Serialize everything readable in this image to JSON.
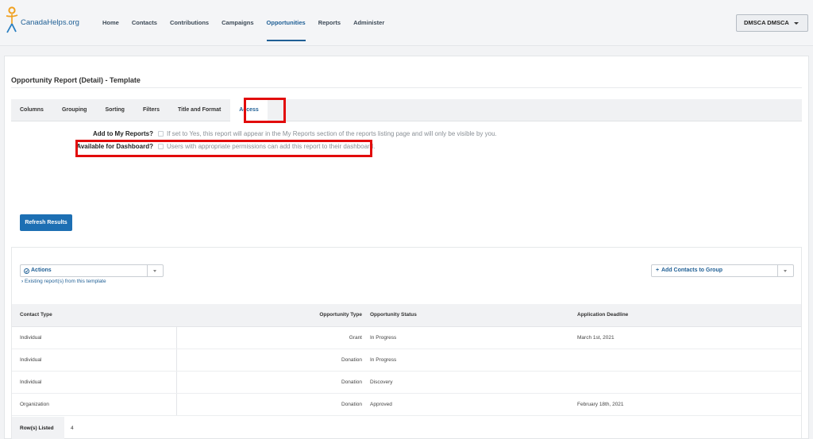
{
  "brand": {
    "name": "CanadaHelps.org",
    "accent": "#1f5f95",
    "highlight": "#e20b0b"
  },
  "nav": {
    "items": [
      {
        "label": "Home",
        "active": false
      },
      {
        "label": "Contacts",
        "active": false
      },
      {
        "label": "Contributions",
        "active": false
      },
      {
        "label": "Campaigns",
        "active": false
      },
      {
        "label": "Opportunities",
        "active": true
      },
      {
        "label": "Reports",
        "active": false
      },
      {
        "label": "Administer",
        "active": false
      }
    ],
    "user_label": "DMSCA DMSCA"
  },
  "page": {
    "title": "Opportunity Report (Detail) - Template"
  },
  "tabs": [
    {
      "label": "Columns"
    },
    {
      "label": "Grouping"
    },
    {
      "label": "Sorting"
    },
    {
      "label": "Filters"
    },
    {
      "label": "Title and Format"
    },
    {
      "label": "Access",
      "active": true
    }
  ],
  "access": {
    "my_reports": {
      "label": "Add to My Reports?",
      "checked": false,
      "help": "If set to Yes, this report will appear in the My Reports section of the reports listing page and will only be visible by you."
    },
    "dashboard": {
      "label": "Available for Dashboard?",
      "checked": false,
      "help": "Users with appropriate permissions can add this report to their dashboard."
    }
  },
  "refresh_label": "Refresh Results",
  "actions": {
    "label": "Actions",
    "existing_link": "Existing report(s) from this template",
    "add_to_group_label": "Add Contacts to Group"
  },
  "table": {
    "headers": [
      "Contact Type",
      "Opportunity Type",
      "Opportunity Status",
      "Application Deadline"
    ],
    "rows": [
      [
        "Individual",
        "Grant",
        "In Progress",
        "March 1st, 2021"
      ],
      [
        "Individual",
        "Donation",
        "In Progress",
        ""
      ],
      [
        "Individual",
        "Donation",
        "Discovery",
        ""
      ],
      [
        "Organization",
        "Donation",
        "Approved",
        "February 18th, 2021"
      ]
    ],
    "footer_label": "Row(s) Listed",
    "footer_value": "4"
  }
}
